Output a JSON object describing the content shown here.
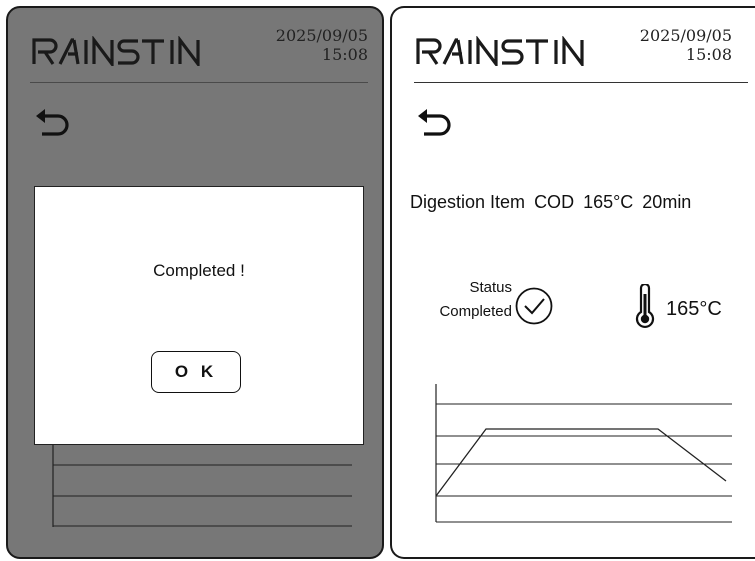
{
  "left_screen": {
    "logo": "RAINSTIN",
    "date": "2025/09/05",
    "time": "15:08",
    "icons": {
      "back": "back-arrow-icon"
    },
    "dialog": {
      "message": "Completed !",
      "ok_label": "O K"
    }
  },
  "right_screen": {
    "logo": "RAINSTIN",
    "date": "2025/09/05",
    "time": "15:08",
    "icons": {
      "back": "back-arrow-icon",
      "status": "check-circle-icon",
      "thermometer": "thermometer-icon"
    },
    "digestion": {
      "label": "Digestion Item",
      "item": "COD",
      "temperature": "165°C",
      "duration": "20min"
    },
    "status": {
      "label": "Status",
      "value": "Completed"
    },
    "current_temperature": "165°C"
  },
  "colors": {
    "overlay_gray": "#777777",
    "panel_border": "#1a1a1a",
    "line": "#333333"
  }
}
